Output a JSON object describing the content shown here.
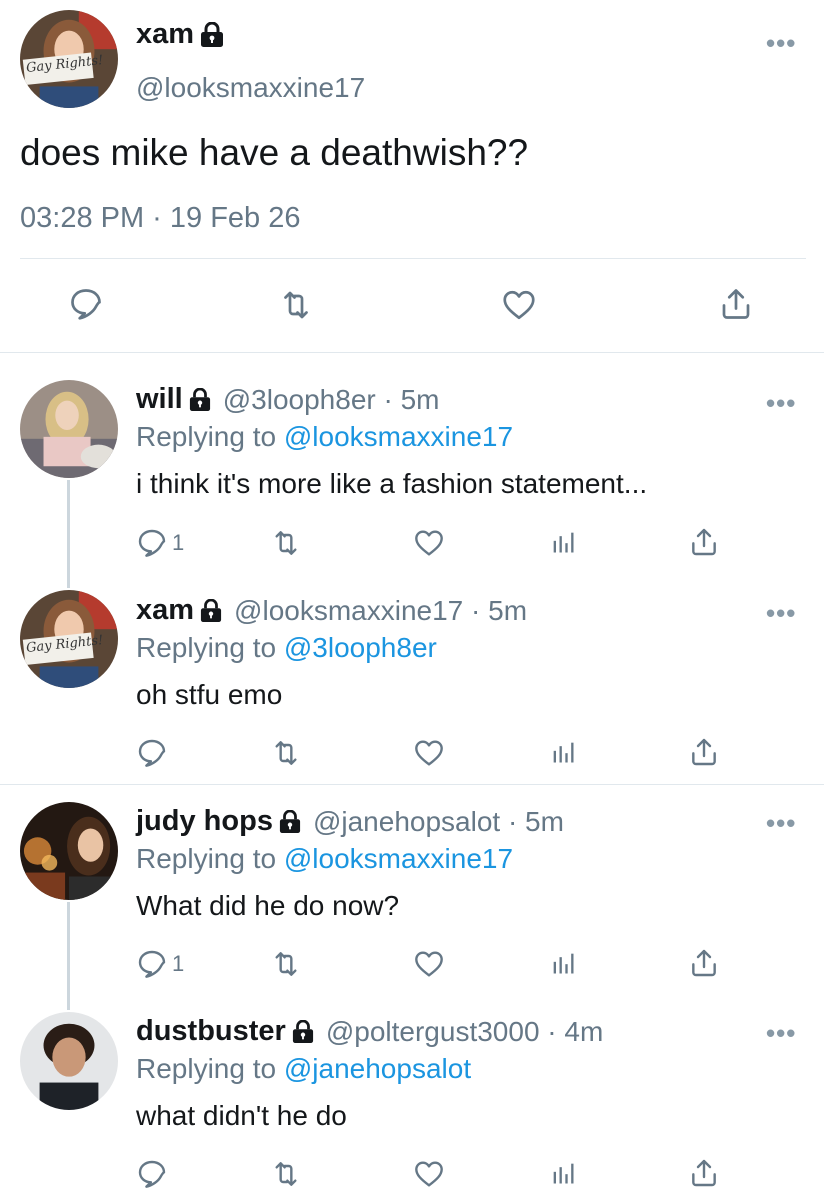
{
  "main_tweet": {
    "name": "xam",
    "handle": "@looksmaxxine17",
    "text": "does mike have a deathwish??",
    "timestamp": "03:28 PM · 19 Feb 26",
    "avatar_sign": "Gay Rights!"
  },
  "replies": [
    {
      "name": "will",
      "handle": "@3looph8er · 5m",
      "replying_prefix": "Replying to",
      "replying_to": "@looksmaxxine17",
      "text": "i think it's more like a fashion statement...",
      "reply_count": "1"
    },
    {
      "name": "xam",
      "handle": "@looksmaxxine17 · 5m",
      "replying_prefix": "Replying to",
      "replying_to": "@3looph8er",
      "text": "oh stfu emo",
      "reply_count": "",
      "avatar_sign": "Gay Rights!"
    },
    {
      "name": "judy hops",
      "handle": "@janehopsalot · 5m",
      "replying_prefix": "Replying to",
      "replying_to": "@looksmaxxine17",
      "text": "What did he do now?",
      "reply_count": "1"
    },
    {
      "name": "dustbuster",
      "handle": "@poltergust3000 · 4m",
      "replying_prefix": "Replying to",
      "replying_to": "@janehopsalot",
      "text": "what didn't he do",
      "reply_count": ""
    }
  ],
  "icons": {
    "reply": "reply-icon",
    "retweet": "retweet-icon",
    "like": "heart-icon",
    "analytics": "analytics-icon",
    "share": "share-icon",
    "more": "more-icon",
    "lock": "lock-icon"
  },
  "colors": {
    "link": "#1b95e0",
    "secondary_text": "#657786",
    "divider": "#e1e8ed",
    "thread_line": "#ccd6dd"
  }
}
